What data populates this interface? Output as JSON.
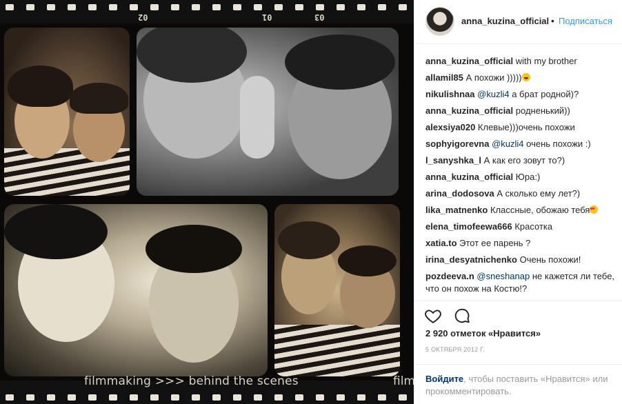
{
  "photo": {
    "caption": "filmmaking >>> behind the scenes",
    "caption_fragment": "film",
    "frame_numbers": [
      "02",
      "03",
      "01"
    ]
  },
  "header": {
    "username": "anna_kuzina_official",
    "separator": "•",
    "follow_label": "Подписаться"
  },
  "comments": [
    {
      "user": "anna_kuzina_official",
      "text": "with my brother"
    },
    {
      "user": "allamil85",
      "text": "А похожи )))))",
      "emoji": "grin"
    },
    {
      "user": "nikulishnaa",
      "mention": "@kuzli4",
      "text": "а брат родной)?"
    },
    {
      "user": "anna_kuzina_official",
      "text": "родненький))"
    },
    {
      "user": "alexsiya020",
      "text": "Клевые)))очень похожи"
    },
    {
      "user": "sophyigorevna",
      "mention": "@kuzli4",
      "text": "очень похожи :)"
    },
    {
      "user": "l_sanyshka_l",
      "text": "А как его зовут то?)"
    },
    {
      "user": "anna_kuzina_official",
      "text": "Юра:)"
    },
    {
      "user": "arina_dodosova",
      "text": "А сколько ему лет?)"
    },
    {
      "user": "lika_matnenko",
      "text": "Классные, обожаю тебя",
      "emoji": "hearteyes"
    },
    {
      "user": "elena_timofeewa666",
      "text": "Красотка"
    },
    {
      "user": "xatia.to",
      "text": "Этот ее парень ?"
    },
    {
      "user": "irina_desyatnichenko",
      "text": "Очень похожи!"
    },
    {
      "user": "pozdeeva.n",
      "mention": "@sneshanap",
      "text": "не кажется ли тебе, что он похож на Костю!?"
    }
  ],
  "actions": {
    "like_icon": "heart-icon",
    "comment_icon": "comment-bubble-icon"
  },
  "likes_text": "2 920 отметок «Нравится»",
  "date_text": "5 октября 2012 г.",
  "login": {
    "link": "Войдите",
    "text": ", чтобы поставить «Нравится» или прокомментировать."
  },
  "colors": {
    "link_blue": "#3897f0",
    "username_dark_blue": "#003569",
    "muted_gray": "#999999"
  }
}
